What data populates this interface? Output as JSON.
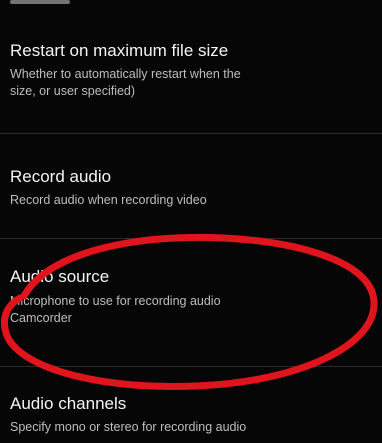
{
  "settings": {
    "items": [
      {
        "title": "Restart on maximum file size",
        "summary_lines": [
          "Whether to automatically restart when the ",
          "size, or user specified)"
        ]
      },
      {
        "title": "Record audio",
        "summary_lines": [
          "Record audio when recording video"
        ]
      },
      {
        "title": "Audio source",
        "summary_lines": [
          "Microphone to use for recording audio"
        ],
        "value": "Camcorder"
      },
      {
        "title": "Audio channels",
        "summary_lines": [
          "Specify mono or stereo for recording audio"
        ]
      }
    ]
  },
  "annotation": {
    "color": "#e0141c"
  },
  "colors": {
    "background": "#060606",
    "title_text": "#f4f4f4",
    "summary_text": "#bdbdbd",
    "divider": "#2b2b2b"
  }
}
